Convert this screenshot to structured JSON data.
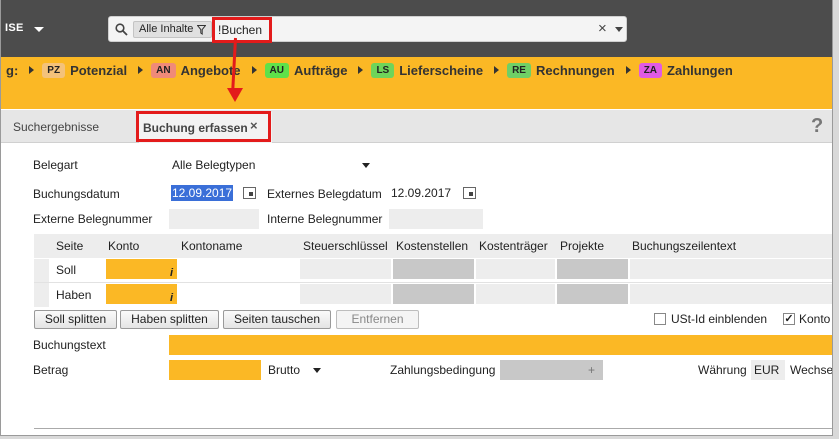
{
  "header": {
    "brand_fragment": "ISE",
    "search": {
      "scope_label": "Alle Inhalte",
      "query": "!Buchen",
      "clear_glyph": "×"
    }
  },
  "nav": {
    "lead": "g:",
    "items": [
      {
        "badge": "PZ",
        "label": "Potenzial",
        "color": "#f4c27a"
      },
      {
        "badge": "AN",
        "label": "Angebote",
        "color": "#f08a78"
      },
      {
        "badge": "AU",
        "label": "Aufträge",
        "color": "#5fe14a"
      },
      {
        "badge": "LS",
        "label": "Lieferscheine",
        "color": "#6ed45a"
      },
      {
        "badge": "RE",
        "label": "Rechnungen",
        "color": "#6fcf66"
      },
      {
        "badge": "ZA",
        "label": "Zahlungen",
        "color": "#e05ae4"
      }
    ]
  },
  "tabs": {
    "results": "Suchergebnisse",
    "active": "Buchung erfassen",
    "close_glyph": "×",
    "help_glyph": "?"
  },
  "form": {
    "belegart_label": "Belegart",
    "belegart_value": "Alle Belegtypen",
    "buchungsdatum_label": "Buchungsdatum",
    "buchungsdatum_value": "12.09.2017",
    "ext_belegdatum_label": "Externes Belegdatum",
    "ext_belegdatum_value": "12.09.2017",
    "ext_belegnummer_label": "Externe Belegnummer",
    "int_belegnummer_label": "Interne Belegnummer",
    "grid": {
      "columns": [
        "Seite",
        "Konto",
        "Kontoname",
        "Steuerschlüssel",
        "Kostenstellen",
        "Kostenträger",
        "Projekte",
        "Buchungszeilentext"
      ],
      "rows": [
        "Soll",
        "Haben"
      ],
      "info_glyph": "i"
    },
    "buttons": {
      "soll_splitten": "Soll splitten",
      "haben_splitten": "Haben splitten",
      "seiten_tauschen": "Seiten tauschen",
      "entfernen": "Entfernen"
    },
    "ust_label": "USt-Id einblenden",
    "konto_label": "Konto",
    "konto_checked": true,
    "buchungstext_label": "Buchungstext",
    "betrag_label": "Betrag",
    "brutto_value": "Brutto",
    "zahlungsbedingung_label": "Zahlungsbedingung",
    "zahlungsbedingung_plus": "+",
    "waehrung_label": "Währung",
    "waehrung_value": "EUR",
    "wechsel_label": "Wechse"
  },
  "colors": {
    "topbar": "#4c4c4c",
    "accent_yellow": "#fbb825",
    "annotation_red": "#e31b1b"
  }
}
